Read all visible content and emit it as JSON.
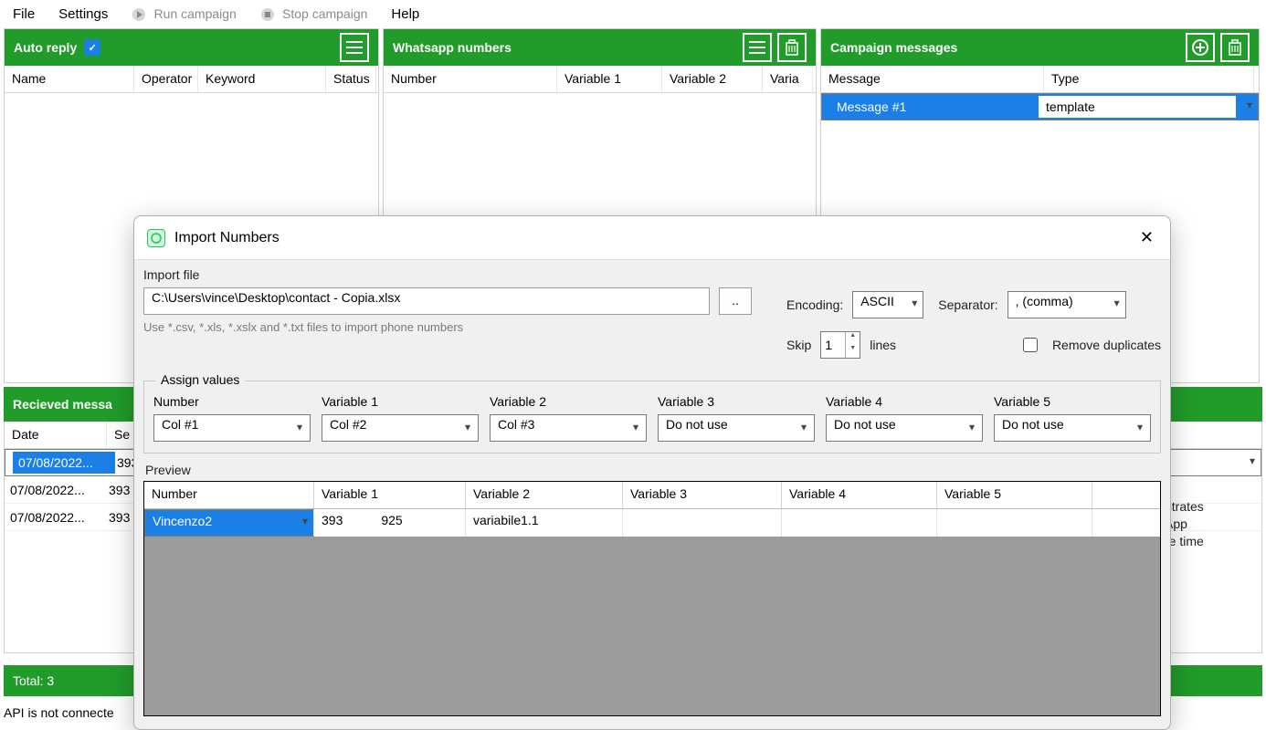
{
  "menu": {
    "file": "File",
    "settings": "Settings",
    "run": "Run campaign",
    "stop": "Stop campaign",
    "help": "Help"
  },
  "panel_autoreply": {
    "title": "Auto reply",
    "cols": {
      "name": "Name",
      "operator": "Operator",
      "keyword": "Keyword",
      "status": "Status"
    }
  },
  "panel_whatsapp": {
    "title": "Whatsapp numbers",
    "cols": {
      "number": "Number",
      "v1": "Variable 1",
      "v2": "Variable 2",
      "v3": "Varia"
    }
  },
  "panel_campaign": {
    "title": "Campaign messages",
    "cols": {
      "message": "Message",
      "type": "Type"
    },
    "rows": [
      {
        "message": "Message #1",
        "type": "template"
      }
    ]
  },
  "received": {
    "title": "Recieved messa",
    "cols": {
      "date": "Date",
      "sender": "Se"
    },
    "rows": [
      {
        "date": "07/08/2022...",
        "sender": "393"
      },
      {
        "date": "07/08/2022...",
        "sender": "393"
      },
      {
        "date": "07/08/2022...",
        "sender": "393"
      }
    ]
  },
  "sidetext": {
    "l1": "nstrates",
    "l2": "sApp",
    "l3": "the time"
  },
  "totals": {
    "label": "Total: 3"
  },
  "statusbar": {
    "text": "API is not connecte"
  },
  "dialog": {
    "title": "Import Numbers",
    "import_file_label": "Import file",
    "path": "C:\\Users\\vince\\Desktop\\contact - Copia.xlsx",
    "browse": "..",
    "hint": "Use *.csv, *.xls, *.xslx and *.txt files  to import phone numbers",
    "encoding_label": "Encoding:",
    "encoding_value": "ASCII",
    "separator_label": "Separator:",
    "separator_value": ", (comma)",
    "skip_label": "Skip",
    "skip_value": "1",
    "lines_label": "lines",
    "remove_dup": "Remove duplicates",
    "assign": {
      "legend": "Assign values",
      "labels": {
        "number": "Number",
        "v1": "Variable 1",
        "v2": "Variable 2",
        "v3": "Variable 3",
        "v4": "Variable 4",
        "v5": "Variable 5"
      },
      "values": {
        "number": "Col #1",
        "v1": "Col #2",
        "v2": "Col #3",
        "v3": "Do not use",
        "v4": "Do not use",
        "v5": "Do not use"
      }
    },
    "preview": {
      "label": "Preview",
      "cols": {
        "number": "Number",
        "v1": "Variable 1",
        "v2": "Variable 2",
        "v3": "Variable 3",
        "v4": "Variable 4",
        "v5": "Variable 5"
      },
      "rows": [
        {
          "number": "Vincenzo2",
          "v1a": "393",
          "v1b": "925",
          "v2": "variabile1.1",
          "v3": "",
          "v4": "",
          "v5": ""
        }
      ]
    }
  }
}
